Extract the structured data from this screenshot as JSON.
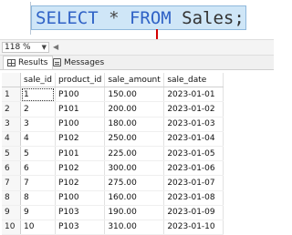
{
  "editor": {
    "kw_select": "SELECT",
    "star": " * ",
    "kw_from": "FROM",
    "table": " Sales;"
  },
  "toolbar": {
    "zoom": "118 %"
  },
  "tabs": {
    "results": "Results",
    "messages": "Messages"
  },
  "grid": {
    "headers": [
      "sale_id",
      "product_id",
      "sale_amount",
      "sale_date"
    ],
    "rows": [
      [
        "1",
        "1",
        "P100",
        "150.00",
        "2023-01-01"
      ],
      [
        "2",
        "2",
        "P101",
        "200.00",
        "2023-01-02"
      ],
      [
        "3",
        "3",
        "P100",
        "180.00",
        "2023-01-03"
      ],
      [
        "4",
        "4",
        "P102",
        "250.00",
        "2023-01-04"
      ],
      [
        "5",
        "5",
        "P101",
        "225.00",
        "2023-01-05"
      ],
      [
        "6",
        "6",
        "P102",
        "300.00",
        "2023-01-06"
      ],
      [
        "7",
        "7",
        "P102",
        "275.00",
        "2023-01-07"
      ],
      [
        "8",
        "8",
        "P100",
        "160.00",
        "2023-01-08"
      ],
      [
        "9",
        "9",
        "P103",
        "190.00",
        "2023-01-09"
      ],
      [
        "10",
        "10",
        "P103",
        "310.00",
        "2023-01-10"
      ]
    ]
  },
  "colors": {
    "keyword": "#2f62c6",
    "arrow": "#d40000",
    "selection": "#cfe6f7"
  }
}
